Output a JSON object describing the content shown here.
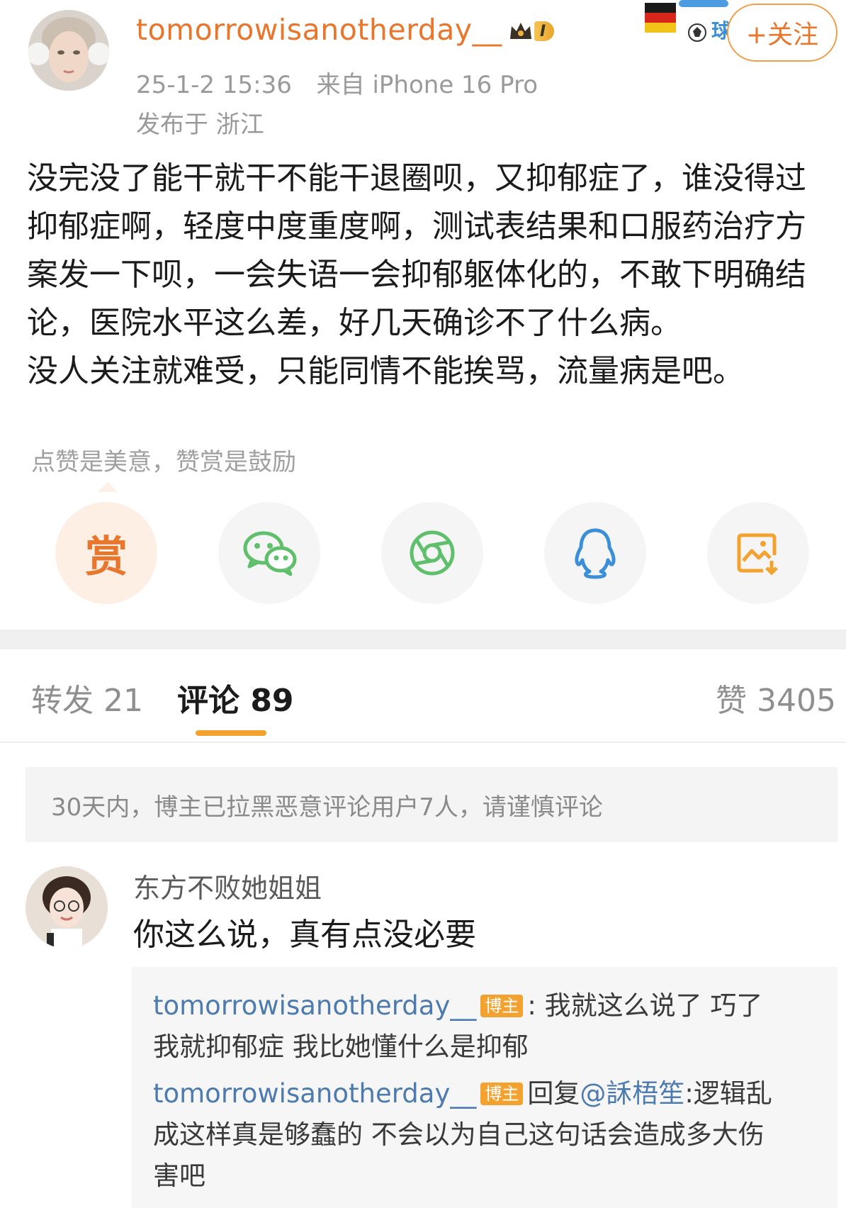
{
  "post": {
    "username": "tomorrowisanotherday__",
    "vip_level": "I",
    "datetime": "25-1-2 15:36",
    "source": "来自 iPhone 16 Pro",
    "location": "发布于 浙江",
    "follow_label": "+关注",
    "badge_text": "球",
    "content_lines": [
      "没完没了能干就干不能干退圈呗，又抑郁症了，谁没得过",
      "抑郁症啊，轻度中度重度啊，测试表结果和口服药治疗方",
      "案发一下呗，一会失语一会抑郁躯体化的，不敢下明确结",
      "论，医院水平这么差，好几天确诊不了什么病。",
      "没人关注就难受，只能同情不能挨骂，流量病是吧。"
    ]
  },
  "actions": {
    "tip": "点赞是美意，赞赏是鼓励",
    "reward_label": "赏",
    "icons": [
      "reward-icon",
      "wechat-icon",
      "moments-icon",
      "qq-icon",
      "save-image-icon"
    ]
  },
  "tabs": {
    "repost": "转发 21",
    "comment": "评论 89",
    "like": "赞 3405"
  },
  "notice": "30天内，博主已拉黑恶意评论用户7人，请谨慎评论",
  "comment": {
    "name": "东方不败她姐姐",
    "text": "你这么说，真有点没必要",
    "replies": [
      {
        "user": "tomorrowisanotherday__",
        "tag": "博主",
        "separator": ":",
        "text": " 我就这么说了 巧了我就抑郁症 我比她懂什么是抑郁"
      },
      {
        "user": "tomorrowisanotherday__",
        "tag": "博主",
        "prefix": "回复",
        "at": "@訸梧笙",
        "text": ":逻辑乱成这样真是够蠢的 不会以为自己这句话会造成多大伤害吧"
      }
    ]
  },
  "colors": {
    "accent_orange": "#e8762c",
    "tab_underline": "#f3a22f",
    "link_blue": "#4d7bb0",
    "wechat_green": "#5fbf6b",
    "qq_blue": "#3b8fd9"
  }
}
